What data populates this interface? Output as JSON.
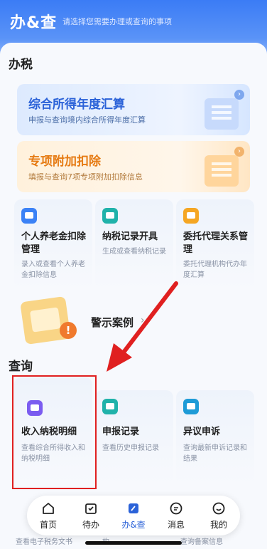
{
  "header": {
    "title": "办&查",
    "subtitle": "请选择您需要办理或查询的事项"
  },
  "tax_section": {
    "title": "办税",
    "banner_annual": {
      "title": "综合所得年度汇算",
      "subtitle": "申报与查询境内综合所得年度汇算"
    },
    "banner_special": {
      "title": "专项附加扣除",
      "subtitle": "填报与查询7项专项附加扣除信息"
    },
    "cards": [
      {
        "title": "个人养老金扣除管理",
        "desc": "录入或查看个人养老金扣除信息",
        "icon": "pension-icon",
        "color": "#3b82f6"
      },
      {
        "title": "纳税记录开具",
        "desc": "生成或查看纳税记录",
        "icon": "tax-record-icon",
        "color": "#20b2aa"
      },
      {
        "title": "委托代理关系管理",
        "desc": "委托代理机构代办年度汇算",
        "icon": "agent-icon",
        "color": "#f5a623"
      }
    ],
    "warning_case": "警示案例",
    "warning_chevron": "›"
  },
  "query_section": {
    "title": "查询",
    "cards": [
      {
        "title": "收入纳税明细",
        "desc": "查看综合所得收入和纳税明细",
        "icon": "income-detail-icon",
        "color": "#7b5cf0"
      },
      {
        "title": "申报记录",
        "desc": "查看历史申报记录",
        "icon": "declaration-record-icon",
        "color": "#20b2aa"
      },
      {
        "title": "异议申诉",
        "desc": "查询最新申诉记录和结果",
        "icon": "appeal-icon",
        "color": "#1e9bd7"
      }
    ],
    "peek_left": "查看电子税务文书",
    "peek_mid": "构",
    "peek_right": "查询备案信息"
  },
  "bottom_nav": {
    "items": [
      {
        "label": "首页",
        "icon": "home-icon"
      },
      {
        "label": "待办",
        "icon": "todo-icon"
      },
      {
        "label": "办&查",
        "icon": "do-query-icon",
        "active": true
      },
      {
        "label": "消息",
        "icon": "message-icon"
      },
      {
        "label": "我的",
        "icon": "profile-icon"
      }
    ]
  },
  "colors": {
    "brand_blue": "#3b7cf5",
    "highlight_red": "#e02020",
    "banner_orange": "#e67a12"
  }
}
